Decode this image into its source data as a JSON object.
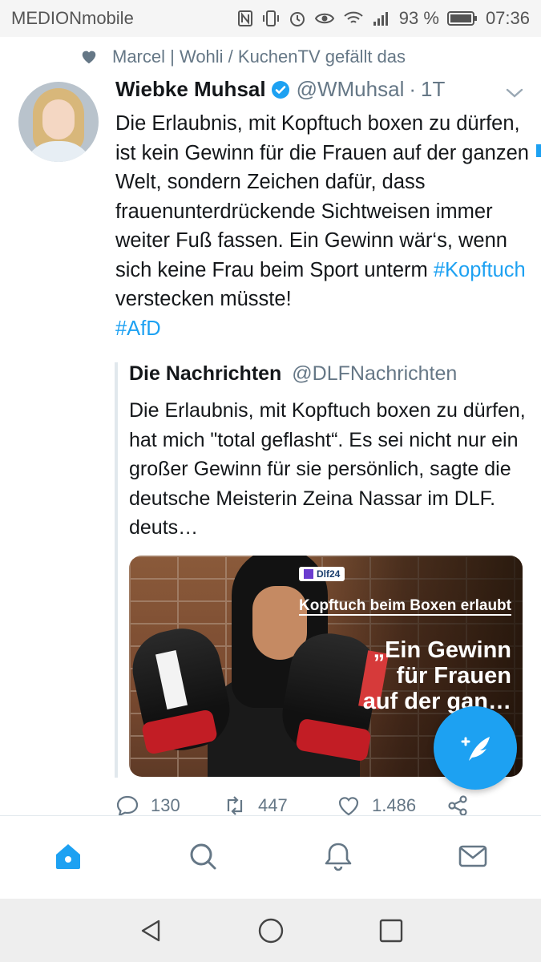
{
  "status_bar": {
    "carrier": "MEDIONmobile",
    "battery": "93 %",
    "time": "07:36"
  },
  "social_context": {
    "text": "Marcel | Wohli / KuchenTV gefällt das"
  },
  "tweet": {
    "author_name": "Wiebke Muhsal",
    "author_handle": "@WMuhsal",
    "separator": "·",
    "time": "1T",
    "text_part1": "Die Erlaubnis, mit Kopftuch boxen zu dürfen, ist kein Gewinn für die Frauen auf der ganzen Welt, sondern Zeichen dafür, dass frauenunterdrückende Sichtweisen immer weiter Fuß fassen. Ein Gewinn wär‘s, wenn sich keine Frau beim Sport unterm ",
    "hashtag1": "#Kopftuch",
    "text_part2": " verstecken müsste!\n",
    "hashtag2": "#AfD"
  },
  "quoted_tweet": {
    "name": "Die Nachrichten",
    "handle": "@DLFNachrichten",
    "text": "Die Erlaubnis, mit Kopftuch boxen zu dürfen, hat mich \"total geflasht“. Es sei nicht nur ein großer Gewinn für sie persönlich, sagte die deutsche Meisterin Zeina Nassar im DLF. deuts…",
    "media": {
      "logo_text": "Dlf24",
      "title": "Kopftuch beim Boxen erlaubt",
      "quote": "„Ein Gewinn für Frauen auf der gan… W…"
    }
  },
  "actions": {
    "replies": "130",
    "retweets": "447",
    "likes": "1.486"
  },
  "colors": {
    "accent": "#1da1f2",
    "muted": "#657786"
  }
}
